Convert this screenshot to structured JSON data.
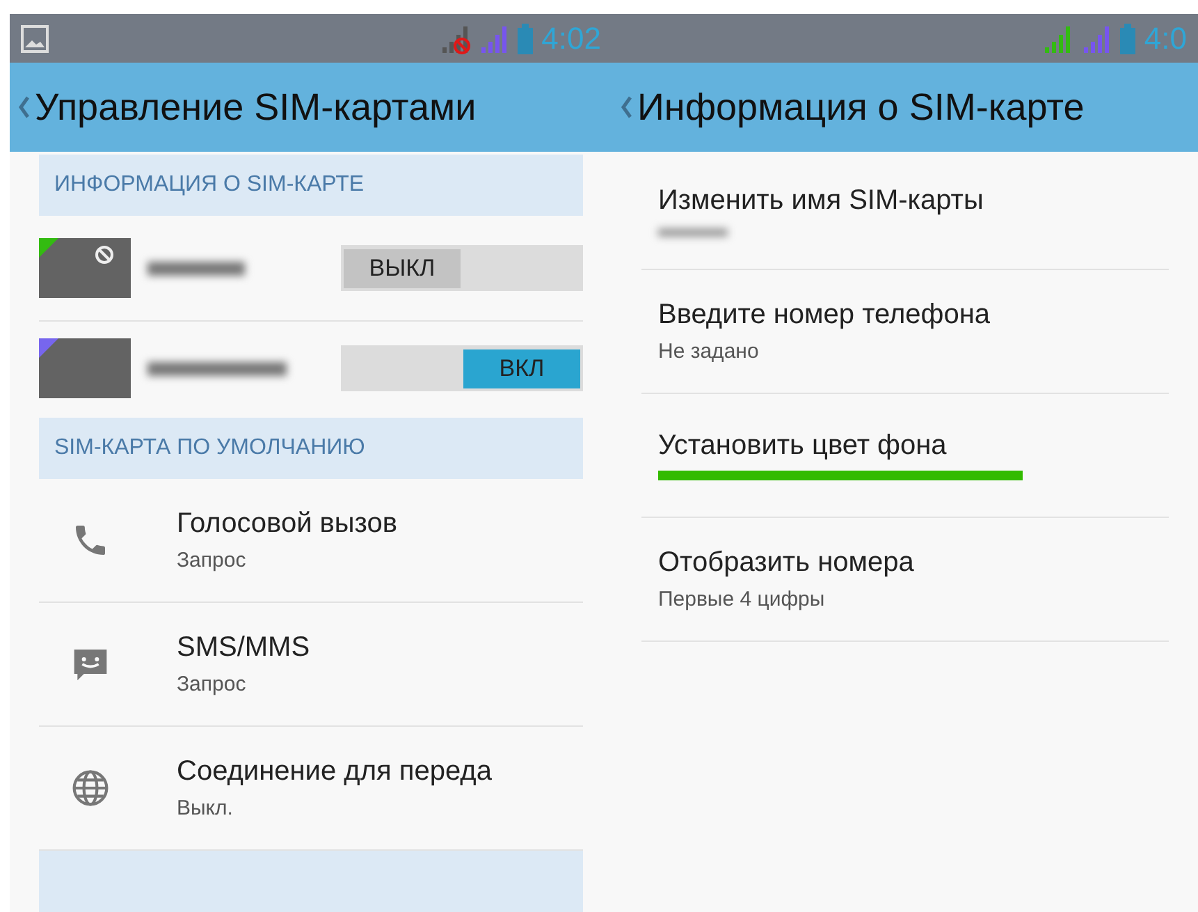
{
  "left_screen": {
    "status_bar": {
      "time": "4:02",
      "signals": [
        {
          "color": "#555555",
          "no_service": true
        },
        {
          "color": "#7755ee",
          "no_service": false
        }
      ]
    },
    "title": "Управление SIM-картами",
    "sim_section": {
      "title": "ИНФОРМАЦИЯ О SIM-КАРТЕ",
      "sim_cards": [
        {
          "color": "#33bb11",
          "blocked": true,
          "on": false,
          "toggle_label": "ВЫКЛ"
        },
        {
          "color": "#7766ee",
          "blocked": false,
          "on": true,
          "toggle_label": "ВКЛ"
        }
      ]
    },
    "default_section": {
      "title": "SIM-КАРТА ПО УМОЛЧАНИЮ",
      "items": [
        {
          "kind": "phone",
          "title": "Голосовой вызов",
          "subtitle": "Запрос"
        },
        {
          "kind": "message",
          "title": "SMS/MMS",
          "subtitle": "Запрос"
        },
        {
          "kind": "globe",
          "title": "Соединение для переда",
          "subtitle": "Выкл."
        }
      ]
    }
  },
  "right_screen": {
    "status_bar": {
      "time": "4:0",
      "signals": [
        {
          "color": "#33bb11",
          "no_service": false
        },
        {
          "color": "#7755ee",
          "no_service": false
        }
      ]
    },
    "title": "Информация о SIM-карте",
    "items": [
      {
        "kind": "hidden",
        "title": "Изменить имя SIM-карты"
      },
      {
        "kind": "text",
        "title": "Введите номер телефона",
        "subtitle": "Не задано"
      },
      {
        "kind": "color",
        "title": "Установить цвет фона",
        "color": "#33bb00"
      },
      {
        "kind": "text",
        "title": "Отобразить номера",
        "subtitle": "Первые 4 цифры"
      }
    ]
  }
}
